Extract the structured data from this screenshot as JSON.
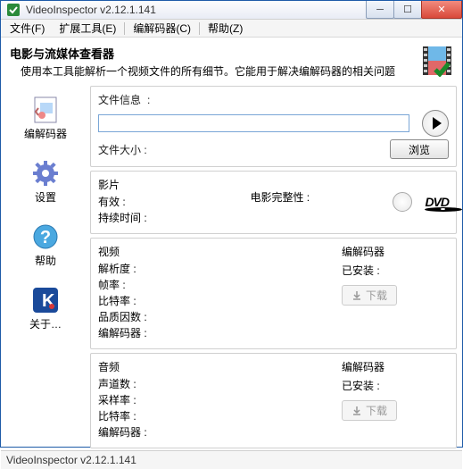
{
  "window": {
    "title": "VideoInspector v2.12.1.141"
  },
  "menu": {
    "file": "文件(F)",
    "tools": "扩展工具(E)",
    "codecs": "编解码器(C)",
    "help": "帮助(Z)"
  },
  "intro": {
    "title": "电影与流媒体查看器",
    "desc": "使用本工具能解析一个视频文件的所有细节。它能用于解决编解码器的相关问题"
  },
  "sidebar": {
    "codec": "编解码器",
    "settings": "设置",
    "help": "帮助",
    "about": "关于…"
  },
  "fileinfo": {
    "label": "文件信息",
    "value": "",
    "filesize_label": "文件大小",
    "filesize_value": "",
    "browse": "浏览"
  },
  "movie": {
    "section": "影片",
    "valid_label": "有效",
    "valid_value": "",
    "complete_label": "电影完整性",
    "complete_value": "",
    "duration_label": "持续时间",
    "duration_value": ""
  },
  "video": {
    "section": "视频",
    "resolution_label": "解析度",
    "fps_label": "帧率",
    "bitrate_label": "比特率",
    "quality_label": "品质因数",
    "codec_label": "编解码器",
    "codec_title": "编解码器",
    "installed_label": "已安装",
    "installed_value": "",
    "download": "下载"
  },
  "audio": {
    "section": "音频",
    "channels_label": "声道数",
    "samplerate_label": "采样率",
    "bitrate_label": "比特率",
    "codec_label": "编解码器",
    "codec_title": "编解码器",
    "installed_label": "已安装",
    "installed_value": "",
    "download": "下载"
  },
  "statusbar": "VideoInspector v2.12.1.141"
}
